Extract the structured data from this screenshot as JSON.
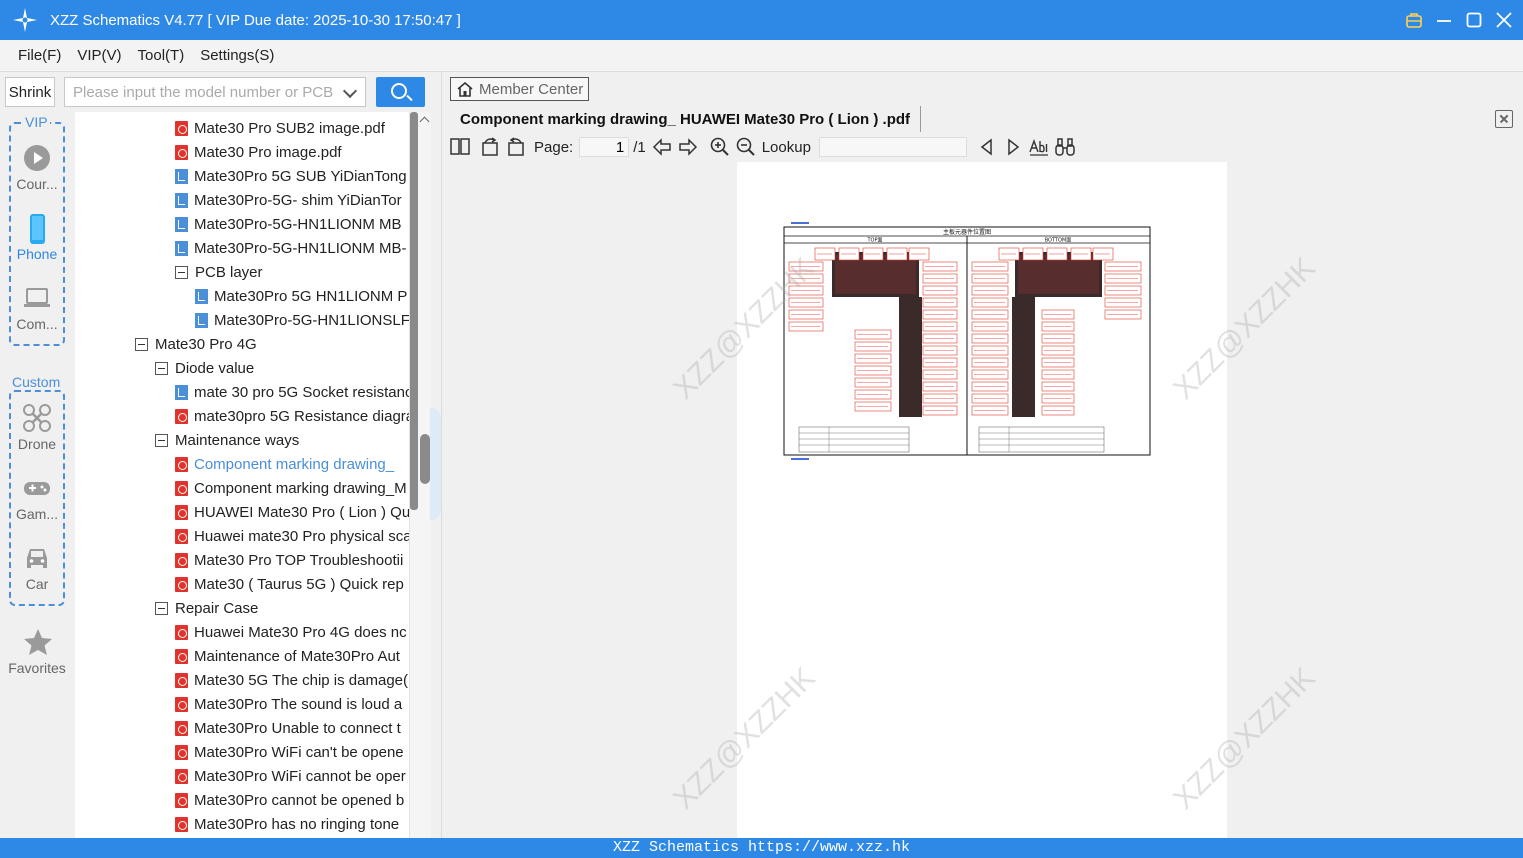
{
  "window": {
    "title": "XZZ Schematics V4.77 [ VIP Due date: 2025-10-30 17:50:47 ]",
    "accent_color": "#2e88e6"
  },
  "menu": [
    "File(F)",
    "VIP(V)",
    "Tool(T)",
    "Settings(S)"
  ],
  "search": {
    "shrink_label": "Shrink",
    "placeholder": "Please input the model number or PCB"
  },
  "categories": {
    "vip_label": "VIP",
    "custom_label": "Custom",
    "items": [
      {
        "label": "Cour...",
        "icon": "play-circle-icon"
      },
      {
        "label": "Phone",
        "icon": "phone-icon",
        "active": true
      },
      {
        "label": "Com...",
        "icon": "laptop-icon"
      },
      {
        "label": "Drone",
        "icon": "drone-icon"
      },
      {
        "label": "Gam...",
        "icon": "gamepad-icon"
      },
      {
        "label": "Car",
        "icon": "car-icon"
      },
      {
        "label": "Favorites",
        "icon": "star-icon"
      }
    ]
  },
  "tree": [
    {
      "indent": 2,
      "type": "pdf",
      "label": "Mate30 Pro SUB2 image.pdf"
    },
    {
      "indent": 2,
      "type": "pdf",
      "label": "Mate30 Pro image.pdf"
    },
    {
      "indent": 2,
      "type": "pcb",
      "label": "Mate30Pro 5G SUB YiDianTong"
    },
    {
      "indent": 2,
      "type": "pcb",
      "label": "Mate30Pro-5G- shim YiDianTor"
    },
    {
      "indent": 2,
      "type": "pcb",
      "label": "Mate30Pro-5G-HN1LIONM MB"
    },
    {
      "indent": 2,
      "type": "pcb",
      "label": "Mate30Pro-5G-HN1LIONM MB-"
    },
    {
      "indent": 2,
      "type": "folder",
      "label": "PCB layer"
    },
    {
      "indent": 3,
      "type": "pcb",
      "label": "Mate30Pro 5G HN1LIONM P"
    },
    {
      "indent": 3,
      "type": "pcb",
      "label": "Mate30Pro-5G-HN1LIONSLF"
    },
    {
      "indent": 0,
      "type": "folder",
      "label": "Mate30 Pro 4G"
    },
    {
      "indent": 1,
      "type": "folder",
      "label": "Diode value"
    },
    {
      "indent": 2,
      "type": "pcb",
      "label": "mate 30 pro 5G Socket resistanc"
    },
    {
      "indent": 2,
      "type": "pdf",
      "label": "mate30pro 5G Resistance diagra"
    },
    {
      "indent": 1,
      "type": "folder",
      "label": "Maintenance ways"
    },
    {
      "indent": 2,
      "type": "pdf",
      "label": "Component marking drawing_",
      "selected": true
    },
    {
      "indent": 2,
      "type": "pdf",
      "label": "Component marking drawing_M"
    },
    {
      "indent": 2,
      "type": "pdf",
      "label": "HUAWEI Mate30 Pro ( Lion ) Qu"
    },
    {
      "indent": 2,
      "type": "pdf",
      "label": "Huawei mate30 Pro physical sca"
    },
    {
      "indent": 2,
      "type": "pdf",
      "label": "Mate30 Pro TOP Troubleshootii"
    },
    {
      "indent": 2,
      "type": "pdf",
      "label": "Mate30 ( Taurus 5G ) Quick rep"
    },
    {
      "indent": 1,
      "type": "folder",
      "label": "Repair Case"
    },
    {
      "indent": 2,
      "type": "pdf",
      "label": "Huawei Mate30 Pro 4G does nc"
    },
    {
      "indent": 2,
      "type": "pdf",
      "label": "Maintenance of Mate30Pro Aut"
    },
    {
      "indent": 2,
      "type": "pdf",
      "label": "Mate30 5G The chip is damage("
    },
    {
      "indent": 2,
      "type": "pdf",
      "label": "Mate30Pro The sound is loud a"
    },
    {
      "indent": 2,
      "type": "pdf",
      "label": "Mate30Pro Unable to connect t"
    },
    {
      "indent": 2,
      "type": "pdf",
      "label": "Mate30Pro WiFi can't be opene"
    },
    {
      "indent": 2,
      "type": "pdf",
      "label": "Mate30Pro WiFi cannot be oper"
    },
    {
      "indent": 2,
      "type": "pdf",
      "label": "Mate30Pro cannot be opened b"
    },
    {
      "indent": 2,
      "type": "pdf",
      "label": "Mate30Pro has no ringing tone"
    }
  ],
  "viewer": {
    "member_center_label": "Member Center",
    "document_tab": "Component marking drawing_ HUAWEI Mate30 Pro ( Lion ) .pdf",
    "page_label": "Page:",
    "page_current": "1",
    "page_total": "/1",
    "lookup_label": "Lookup",
    "watermark_text": "XZZ@XZZHK",
    "drawing_title": "主板元器件位置图",
    "top_label": "TOP面",
    "bottom_label": "BOTTOM面"
  },
  "status": {
    "text": "XZZ Schematics https://www.xzz.hk"
  }
}
